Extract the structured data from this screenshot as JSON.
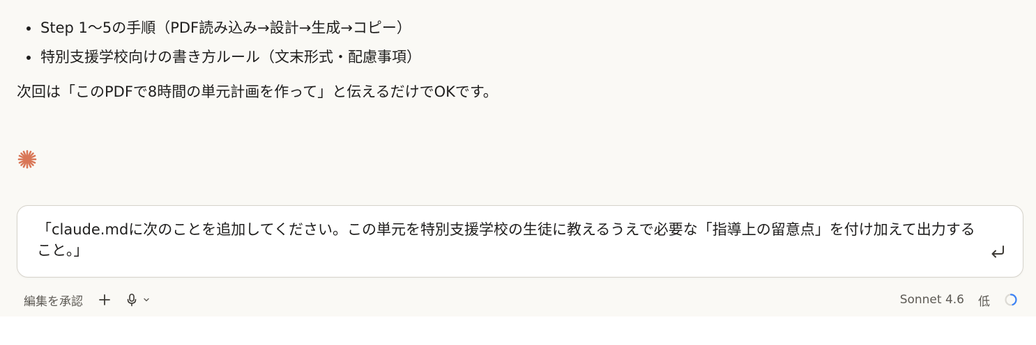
{
  "message": {
    "bullets": [
      "Step 1〜5の手順（PDF読み込み→設計→生成→コピー）",
      "特別支援学校向けの書き方ルール（文末形式・配慮事項）"
    ],
    "paragraph": "次回は「このPDFで8時間の単元計画を作って」と伝えるだけでOKです。"
  },
  "composer": {
    "text": "「claude.mdに次のことを追加してください。この単元を特別支援学校の生徒に教えるうえで必要な「指導上の留意点」を付け加えて出力すること。」"
  },
  "toolbar": {
    "accept_edits_label": "編集を承認",
    "model_label": "Sonnet 4.6",
    "effort_label": "低"
  },
  "colors": {
    "accent": "#d97757",
    "background": "#faf9f5",
    "spinner": "#3b82f6"
  },
  "icons": [
    "claude-spark-icon",
    "return-icon",
    "plus-icon",
    "mic-icon",
    "chevron-down-icon",
    "spinner-icon"
  ]
}
